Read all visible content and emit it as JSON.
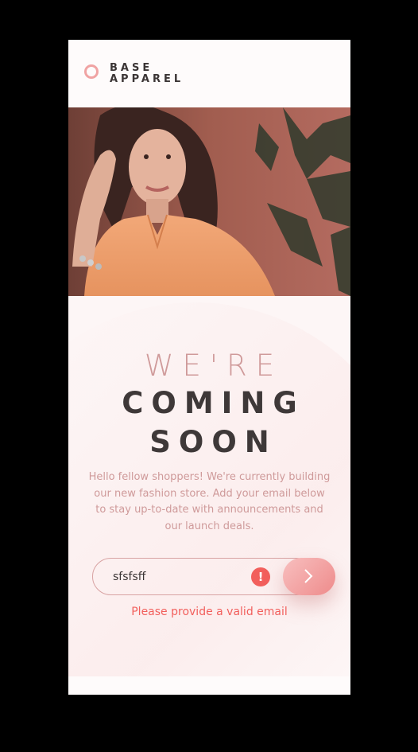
{
  "brand": {
    "line1": "BASE",
    "line2": "APPAREL"
  },
  "hero": {
    "image_icon": "model-photo"
  },
  "headline": {
    "light": "WE'RE",
    "bold_line1": "COMING",
    "bold_line2": "SOON"
  },
  "description": "Hello fellow shoppers! We're currently building our new fashion store. Add your email below to stay up-to-date with announcements and our launch deals.",
  "form": {
    "email_value": "sfsfsff",
    "error_icon_glyph": "!",
    "submit_icon": "chevron-right-icon",
    "error_message": "Please provide a valid email"
  },
  "colors": {
    "accent": "#f0a3a3",
    "error": "#f25f5c",
    "text_dark": "#3e3838",
    "text_light": "#cf9a9a"
  }
}
